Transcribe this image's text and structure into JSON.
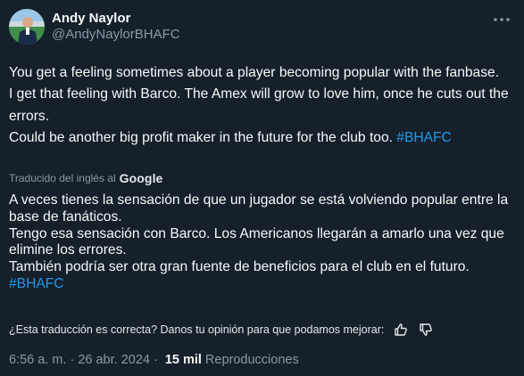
{
  "author": {
    "display_name": "Andy Naylor",
    "handle": "@AndyNaylorBHAFC"
  },
  "original": {
    "line1": "You get a feeling sometimes about a player becoming popular with the fanbase.",
    "line2": "I get that feeling with Barco. The Amex will grow to love him, once he cuts out the errors.",
    "line3_text": "Could be another big profit maker in the future for the club too.",
    "line3_hashtag": "#BHAFC"
  },
  "translation": {
    "attribution": "Traducido del inglés al",
    "provider": "Google",
    "line1": "A veces tienes la sensación de que un jugador se está volviendo popular entre la base de fanáticos.",
    "line2": "Tengo esa sensación con Barco. Los Americanos llegarán a amarlo una vez que elimine los errores.",
    "line3_text": "También podría ser otra gran fuente de beneficios para el club en el futuro.",
    "line3_hashtag": "#BHAFC"
  },
  "feedback": {
    "question": "¿Esta traducción es correcta? Danos tu opinión para que podamos mejorar:"
  },
  "meta": {
    "time": "6:56 a. m.",
    "separator1": "·",
    "date": "26 abr. 2024",
    "separator2": "·",
    "views_count": "15 mil",
    "views_label": "Reproducciones"
  },
  "colors": {
    "background": "#15202b",
    "text": "#f7f9f9",
    "secondary": "#8b98a5",
    "accent": "#1d9bf0"
  },
  "icons": {
    "more": "more-horizontal-icon",
    "thumbs_up": "thumbs-up-icon",
    "thumbs_down": "thumbs-down-icon"
  }
}
